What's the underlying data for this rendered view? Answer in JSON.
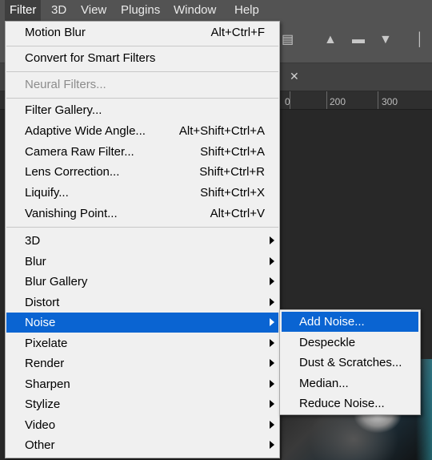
{
  "menubar": {
    "items": [
      "Filter",
      "3D",
      "View",
      "Plugins",
      "Window",
      "Help"
    ],
    "active": "Filter"
  },
  "ruler": {
    "labels": [
      "0",
      "200",
      "300"
    ]
  },
  "filter_menu": {
    "last_filter": {
      "label": "Motion Blur",
      "shortcut": "Alt+Ctrl+F"
    },
    "convert": {
      "label": "Convert for Smart Filters"
    },
    "neural": {
      "label": "Neural Filters...",
      "disabled": true
    },
    "group1": [
      {
        "label": "Filter Gallery...",
        "shortcut": ""
      },
      {
        "label": "Adaptive Wide Angle...",
        "shortcut": "Alt+Shift+Ctrl+A"
      },
      {
        "label": "Camera Raw Filter...",
        "shortcut": "Shift+Ctrl+A"
      },
      {
        "label": "Lens Correction...",
        "shortcut": "Shift+Ctrl+R"
      },
      {
        "label": "Liquify...",
        "shortcut": "Shift+Ctrl+X"
      },
      {
        "label": "Vanishing Point...",
        "shortcut": "Alt+Ctrl+V"
      }
    ],
    "submenus": [
      "3D",
      "Blur",
      "Blur Gallery",
      "Distort",
      "Noise",
      "Pixelate",
      "Render",
      "Sharpen",
      "Stylize",
      "Video",
      "Other"
    ],
    "highlighted": "Noise"
  },
  "noise_submenu": {
    "items": [
      "Add Noise...",
      "Despeckle",
      "Dust & Scratches...",
      "Median...",
      "Reduce Noise..."
    ],
    "highlighted": "Add Noise..."
  },
  "colors": {
    "highlight": "#0a64d2",
    "menu_bg": "#f0f0f0",
    "disabled_text": "#8c8c8c"
  },
  "icons": [
    "align-top-icon",
    "align-vcenter-icon",
    "align-bottom-icon",
    "align-edge-icon",
    "close-icon",
    "submenu-arrow-icon"
  ]
}
